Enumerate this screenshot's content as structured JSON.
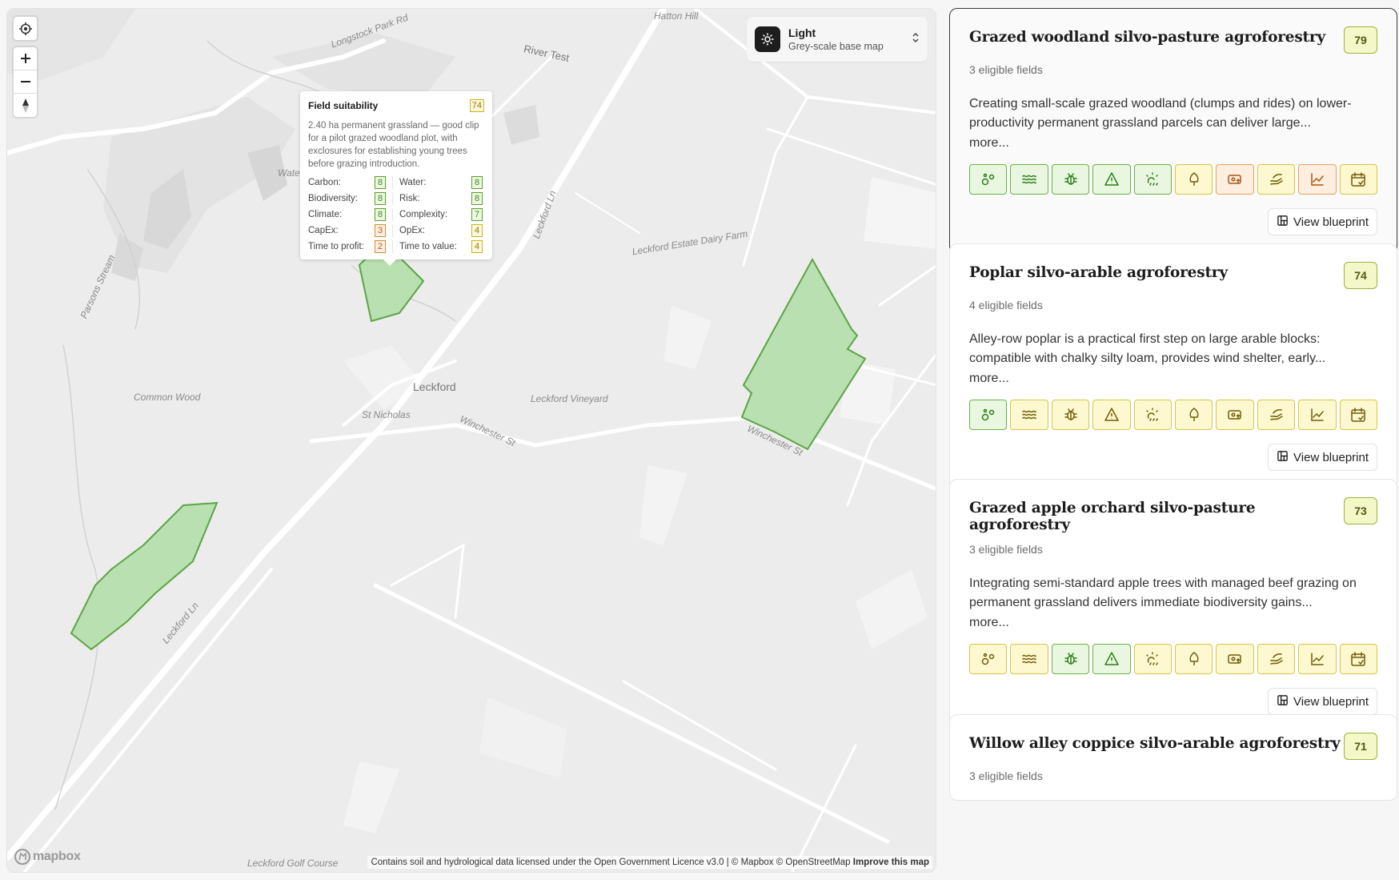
{
  "map": {
    "style_picker": {
      "title": "Light",
      "subtitle": "Grey-scale base map",
      "icon": "sun-icon"
    },
    "controls": {
      "locate": "locate-icon",
      "zoom_in": "+",
      "zoom_out": "−",
      "compass": "compass-icon"
    },
    "labels": {
      "hatton_hill": "Hatton Hill",
      "longstock_park": "Longstock Park Rd",
      "river_test": "River Test",
      "leckford_ln_n": "Leckford Ln",
      "estate_farm": "Leckford Estate Dairy Farm",
      "parsons_stream": "Parsons Stream",
      "water": "Water",
      "common_wood": "Common Wood",
      "leckford": "Leckford",
      "st_nicholas": "St Nicholas",
      "winchester_st": "Winchester St",
      "vineyard": "Leckford Vineyard",
      "winchester_st_2": "Winchester St",
      "leckford_ln_s": "Leckford Ln",
      "golf": "Leckford Golf Course"
    },
    "popup": {
      "title": "Field suitability",
      "score": "74",
      "description": "2.40 ha permanent grassland — good clip for a pilot grazed woodland plot, with exclosures for establishing young trees before grazing introduction.",
      "metrics": [
        {
          "label": "Carbon:",
          "value": "8",
          "level": "green"
        },
        {
          "label": "Water:",
          "value": "8",
          "level": "green"
        },
        {
          "label": "Biodiversity:",
          "value": "8",
          "level": "green"
        },
        {
          "label": "Risk:",
          "value": "8",
          "level": "green"
        },
        {
          "label": "Climate:",
          "value": "8",
          "level": "green"
        },
        {
          "label": "Complexity:",
          "value": "7",
          "level": "green"
        },
        {
          "label": "CapEx:",
          "value": "3",
          "level": "orange"
        },
        {
          "label": "OpEx:",
          "value": "4",
          "level": "yellow"
        },
        {
          "label": "Time to profit:",
          "value": "2",
          "level": "orange"
        },
        {
          "label": "Time to value:",
          "value": "4",
          "level": "yellow"
        }
      ]
    },
    "attribution": "Contains soil and hydrological data licensed under the Open Government Licence v3.0 | © Mapbox © OpenStreetMap",
    "improve_link": "Improve this map",
    "logo": "mapbox"
  },
  "colors": {
    "field_fill": "#b9e0b0",
    "field_stroke": "#5aa544",
    "green": "#2e7d1a",
    "yellow": "#6e5d09",
    "orange": "#a85614"
  },
  "cards": [
    {
      "title": "Grazed woodland silvo-pasture agroforestry",
      "score": "79",
      "fields": "3 eligible fields",
      "text": "Creating small-scale grazed woodland (clumps and rides) on lower-productivity permanent grassland parcels can deliver large...",
      "more": "more...",
      "button": "View blueprint",
      "icons": [
        "green",
        "green",
        "green",
        "green",
        "green",
        "yellow",
        "orange",
        "yellow",
        "orange",
        "yellow"
      ]
    },
    {
      "title": "Poplar silvo-arable agroforestry",
      "score": "74",
      "fields": "4 eligible fields",
      "text": "Alley-row poplar is a practical first step on large arable blocks: compatible with chalky silty loam, provides wind shelter, early...",
      "more": "more...",
      "button": "View blueprint",
      "icons": [
        "green",
        "yellow",
        "yellow",
        "yellow",
        "yellow",
        "yellow",
        "yellow",
        "yellow",
        "yellow",
        "yellow"
      ]
    },
    {
      "title": "Grazed apple orchard silvo-pasture agroforestry",
      "score": "73",
      "fields": "3 eligible fields",
      "text": "Integrating semi-standard apple trees with managed beef grazing on permanent grassland delivers immediate biodiversity gains...",
      "more": "more...",
      "button": "View blueprint",
      "icons": [
        "yellow",
        "yellow",
        "green",
        "green",
        "yellow",
        "yellow",
        "yellow",
        "yellow",
        "yellow",
        "yellow"
      ]
    },
    {
      "title": "Willow alley coppice silvo-arable agroforestry",
      "score": "71",
      "fields": "3 eligible fields"
    }
  ],
  "icon_names": [
    "carbon-icon",
    "water-icon",
    "biodiversity-icon",
    "risk-icon",
    "climate-icon",
    "complexity-icon",
    "capex-icon",
    "opex-icon",
    "time-to-profit-icon",
    "time-to-value-icon"
  ]
}
